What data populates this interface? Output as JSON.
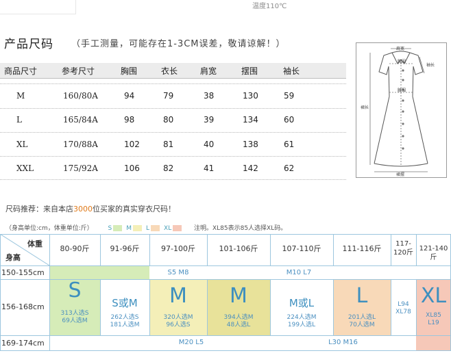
{
  "top": {
    "temperature": "温度110℃"
  },
  "header": {
    "title": "产品尺码",
    "subtitle": "（手工测量，可能存在1-3CM误差，敬请谅解！）"
  },
  "size_table": {
    "columns": [
      "商品尺寸",
      "参考尺寸",
      "胸围",
      "衣长",
      "肩宽",
      "摆围",
      "袖长"
    ],
    "rows": [
      [
        "M",
        "160/80A",
        "94",
        "79",
        "38",
        "130",
        "59"
      ],
      [
        "L",
        "165/84A",
        "98",
        "80",
        "39",
        "134",
        "60"
      ],
      [
        "XL",
        "170/88A",
        "102",
        "81",
        "40",
        "138",
        "61"
      ],
      [
        "XXL",
        "175/92A",
        "106",
        "82",
        "41",
        "142",
        "62"
      ]
    ]
  },
  "diagram": {
    "shoulder": "肩宽",
    "bust": "胸围",
    "waist": "腰围",
    "sleeve": "袖长",
    "length": "裙长",
    "hem": "裙摆"
  },
  "recommend": {
    "prefix": "尺码推荐：来自本店",
    "count": "3000",
    "suffix": "位买家的真实穿衣尺码！"
  },
  "legend": {
    "units": "（身高单位:cm，体重单位:斤）",
    "items": [
      {
        "label": "S",
        "color": "#d6ecb8"
      },
      {
        "label": "M",
        "color": "#f4efb8"
      },
      {
        "label": "L",
        "color": "#f8d9b8"
      },
      {
        "label": "XL",
        "color": "#f6c8b8"
      }
    ],
    "note": "注明。XL85表示85人选择XL码。"
  },
  "grid": {
    "corner_weight": "体重",
    "corner_height": "身高",
    "weights": [
      "80-90斤",
      "91-96斤",
      "97-100斤",
      "101-106斤",
      "107-110斤",
      "111-116斤",
      "117-120斤",
      "121-140斤"
    ],
    "heights": [
      "150-155cm",
      "156-168cm",
      "169-174cm"
    ],
    "row1_a": "S5  M8",
    "row1_b": "M10  L7",
    "row3_a": "M20  L5",
    "row3_b": "L30  M16",
    "cells": [
      {
        "size": "S",
        "l1": "313人选S",
        "l2": "69人选M",
        "color": "#d6ecb8"
      },
      {
        "size": "S或M",
        "l1": "262人选S",
        "l2": "181人选M",
        "color": "#ffffff"
      },
      {
        "size": "M",
        "l1": "320人选M",
        "l2": "96人选S",
        "color": "#f4efb8"
      },
      {
        "size": "M",
        "l1": "394人选M",
        "l2": "48人选L",
        "color": "#e8e29a"
      },
      {
        "size": "M或L",
        "l1": "224人选M",
        "l2": "199人选L",
        "color": "#ffffff"
      },
      {
        "size": "L",
        "l1": "201人选L",
        "l2": "70人选M",
        "color": "#f8d9b8"
      },
      {
        "size": "",
        "l1": "L94",
        "l2": "XL78",
        "color": "#ffffff"
      },
      {
        "size": "XL",
        "l1": "XL85",
        "l2": "L19",
        "color": "#f6c8b8"
      }
    ]
  }
}
